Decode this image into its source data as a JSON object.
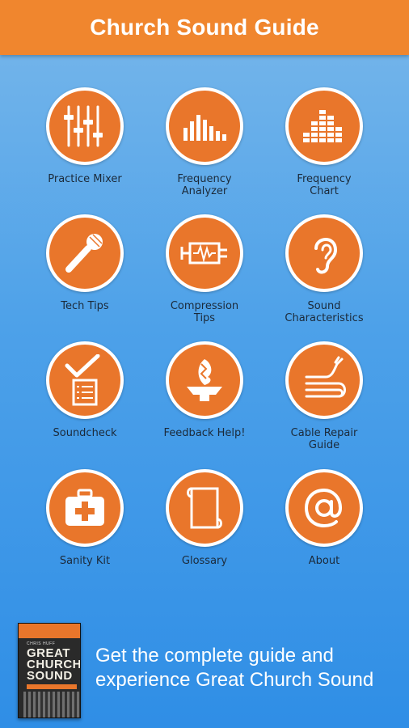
{
  "header": {
    "title": "Church Sound Guide"
  },
  "tiles": [
    {
      "label": "Practice Mixer",
      "icon": "mixer-faders-icon"
    },
    {
      "label": "Frequency\nAnalyzer",
      "icon": "frequency-analyzer-icon"
    },
    {
      "label": "Frequency\nChart",
      "icon": "frequency-chart-icon"
    },
    {
      "label": "Tech Tips",
      "icon": "microphone-icon"
    },
    {
      "label": "Compression\nTips",
      "icon": "compression-clamp-icon"
    },
    {
      "label": "Sound\nCharacteristics",
      "icon": "ear-icon"
    },
    {
      "label": "Soundcheck",
      "icon": "checklist-icon"
    },
    {
      "label": "Feedback Help!",
      "icon": "feedback-wave-icon"
    },
    {
      "label": "Cable Repair\nGuide",
      "icon": "cable-icon"
    },
    {
      "label": "Sanity Kit",
      "icon": "first-aid-kit-icon"
    },
    {
      "label": "Glossary",
      "icon": "scroll-icon"
    },
    {
      "label": "About",
      "icon": "at-sign-icon"
    }
  ],
  "promo": {
    "book_author": "CHRIS HUFF",
    "book_title": "GREAT CHURCH SOUND",
    "text": "Get the complete guide and experience Great Church Sound"
  },
  "colors": {
    "accent": "#e9762b",
    "header": "#f0862e",
    "background": "#4da1e9"
  }
}
